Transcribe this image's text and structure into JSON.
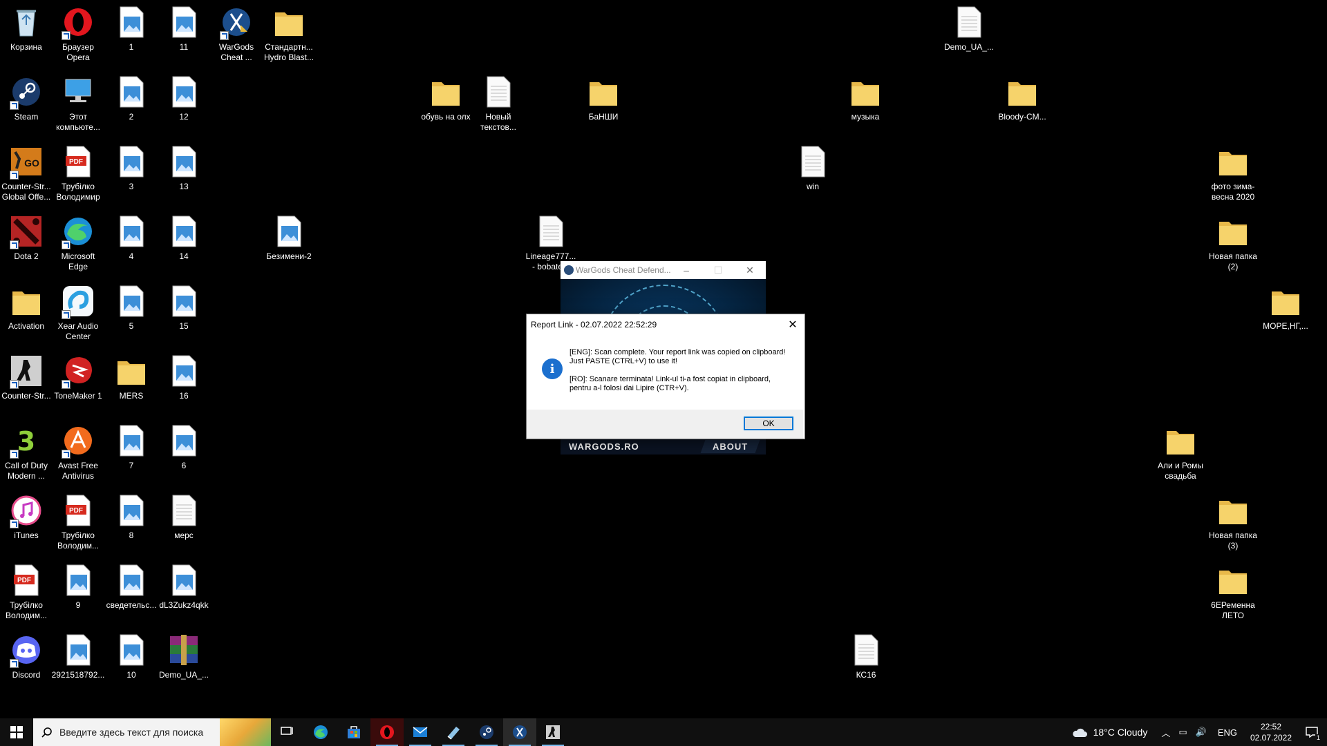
{
  "desktop": {
    "icons": [
      {
        "label": "Корзина",
        "type": "recycle"
      },
      {
        "label": "Браузер\nOpera",
        "type": "opera",
        "shortcut": true
      },
      {
        "label": "1",
        "type": "image"
      },
      {
        "label": "11",
        "type": "image"
      },
      {
        "label": "WarGods\nCheat ...",
        "type": "wargods",
        "shortcut": true
      },
      {
        "label": "Стандартн...\nHydro Blast...",
        "type": "folder"
      },
      {
        "label": "Demo_UA_...",
        "type": "doc"
      },
      {
        "label": "Steam",
        "type": "steam",
        "shortcut": true
      },
      {
        "label": "Этот\nкомпьюте...",
        "type": "pc"
      },
      {
        "label": "2",
        "type": "image"
      },
      {
        "label": "12",
        "type": "image"
      },
      {
        "label": "обувь на олх",
        "type": "folder"
      },
      {
        "label": "Новый\nтекстов...",
        "type": "doc"
      },
      {
        "label": "БаНШИ",
        "type": "folder"
      },
      {
        "label": "музыка",
        "type": "folder"
      },
      {
        "label": "Bloody-CM...",
        "type": "folder"
      },
      {
        "label": "Counter-Str...\nGlobal Offe...",
        "type": "csgo",
        "shortcut": true
      },
      {
        "label": "Трубілко\nВолодимир",
        "type": "pdf"
      },
      {
        "label": "3",
        "type": "image"
      },
      {
        "label": "13",
        "type": "image"
      },
      {
        "label": "win",
        "type": "doc"
      },
      {
        "label": "фото зима-\nвесна 2020",
        "type": "folder"
      },
      {
        "label": "Dota 2",
        "type": "dota",
        "shortcut": true
      },
      {
        "label": "Microsoft\nEdge",
        "type": "edge",
        "shortcut": true
      },
      {
        "label": "4",
        "type": "image"
      },
      {
        "label": "14",
        "type": "image"
      },
      {
        "label": "Безимени-2",
        "type": "image"
      },
      {
        "label": "Lineage777...\n- bobate...",
        "type": "doc"
      },
      {
        "label": "Новая папка\n(2)",
        "type": "folder"
      },
      {
        "label": "Activation",
        "type": "folder"
      },
      {
        "label": "Xear Audio\nCenter",
        "type": "xear",
        "shortcut": true
      },
      {
        "label": "5",
        "type": "image"
      },
      {
        "label": "15",
        "type": "image"
      },
      {
        "label": "МОРЕ,НГ,...",
        "type": "folder"
      },
      {
        "label": "Counter-Str...",
        "type": "cs16",
        "shortcut": true
      },
      {
        "label": "ToneMaker 1",
        "type": "tonemaker",
        "shortcut": true
      },
      {
        "label": "MERS",
        "type": "folder"
      },
      {
        "label": "16",
        "type": "image"
      },
      {
        "label": "Call of Duty\nModern ...",
        "type": "cod",
        "shortcut": true
      },
      {
        "label": "Avast Free\nAntivirus",
        "type": "avast",
        "shortcut": true
      },
      {
        "label": "7",
        "type": "image"
      },
      {
        "label": "6",
        "type": "image"
      },
      {
        "label": "Али и Ромы\nсвадьба",
        "type": "folder"
      },
      {
        "label": "iTunes",
        "type": "itunes",
        "shortcut": true
      },
      {
        "label": "Трубілко\nВолодим...",
        "type": "pdf"
      },
      {
        "label": "8",
        "type": "image"
      },
      {
        "label": "мерс",
        "type": "doc"
      },
      {
        "label": "Новая папка\n(3)",
        "type": "folder"
      },
      {
        "label": "Трубілко\nВолодим...",
        "type": "pdf"
      },
      {
        "label": "9",
        "type": "image"
      },
      {
        "label": "сведетельс...",
        "type": "image"
      },
      {
        "label": "dL3Zukz4qkk",
        "type": "image"
      },
      {
        "label": "6ЕРеменна\nЛЕТО",
        "type": "folder"
      },
      {
        "label": "Discord",
        "type": "discord",
        "shortcut": true
      },
      {
        "label": "2921518792...",
        "type": "image"
      },
      {
        "label": "10",
        "type": "image"
      },
      {
        "label": "Demo_UA_...",
        "type": "winrar"
      },
      {
        "label": "КС16",
        "type": "doc"
      }
    ]
  },
  "wargods_window": {
    "title": "WarGods Cheat Defend...",
    "footer_left": "WARGODS.RO",
    "footer_right": "ABOUT"
  },
  "dialog": {
    "title": "Report Link - 02.07.2022 22:52:29",
    "message_eng": "[ENG]: Scan complete. Your report link was copied on clipboard! Just PASTE (CTRL+V) to use it!",
    "message_ro": "[RO]: Scanare terminata! Link-ul ti-a fost copiat in clipboard, pentru a-l folosi dai Lipire (CTR+V).",
    "ok_label": "OK"
  },
  "taskbar": {
    "search_placeholder": "Введите здесь текст для поиска",
    "apps": [
      "task-view",
      "edge",
      "store",
      "opera",
      "mail",
      "notepad",
      "steam",
      "wargods",
      "cs16"
    ],
    "weather": "18°C  Cloudy",
    "language": "ENG",
    "time": "22:52",
    "date": "02.07.2022",
    "notifications": "1"
  }
}
